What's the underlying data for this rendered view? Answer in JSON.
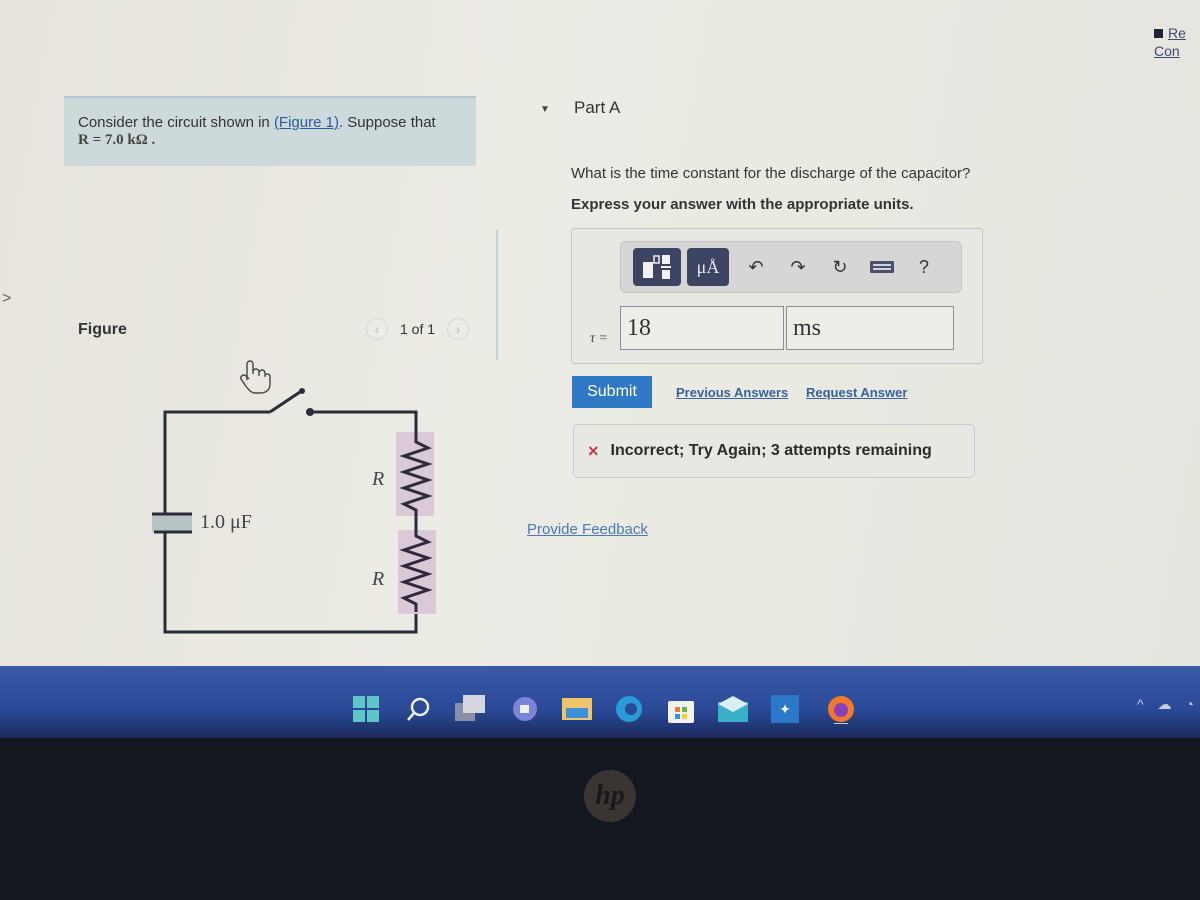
{
  "problem": {
    "intro_prefix": "Consider the circuit shown in ",
    "figure_link": "(Figure 1)",
    "intro_suffix": ". Suppose that",
    "given": "R = 7.0  kΩ ."
  },
  "figure": {
    "title": "Figure",
    "pager_text": "1 of 1",
    "prev_icon": "chevron-left",
    "next_icon": "chevron-right",
    "capacitor_label": "1.0 μF",
    "resistor_labels": [
      "R",
      "R"
    ]
  },
  "part": {
    "title": "Part A",
    "question": "What is the time constant for the discharge of the capacitor?",
    "instruction": "Express your answer with the appropriate units.",
    "toolbar": {
      "templates_icon": "fraction-template-icon",
      "units_label": "μÅ",
      "undo_icon": "undo",
      "redo_icon": "redo",
      "reset_icon": "reset",
      "keyboard_icon": "keyboard",
      "help_label": "?"
    },
    "answer_label": "τ =",
    "answer_value": "18",
    "answer_units": "ms",
    "submit_label": "Submit",
    "previous_answers_label": "Previous Answers",
    "request_answer_label": "Request Answer",
    "feedback_text": "Incorrect; Try Again; 3 attempts remaining",
    "feedback_icon": "×",
    "provide_feedback_label": "Provide Feedback"
  },
  "corner": {
    "line1": "Re",
    "line2": "Con"
  },
  "taskbar": {
    "apps": [
      "start",
      "search",
      "task-view",
      "chat",
      "file-explorer",
      "edge",
      "store",
      "mail",
      "dropbox",
      "firefox"
    ],
    "tray": [
      "^",
      "☁",
      "◔"
    ]
  },
  "bezel": {
    "brand": "hp"
  }
}
